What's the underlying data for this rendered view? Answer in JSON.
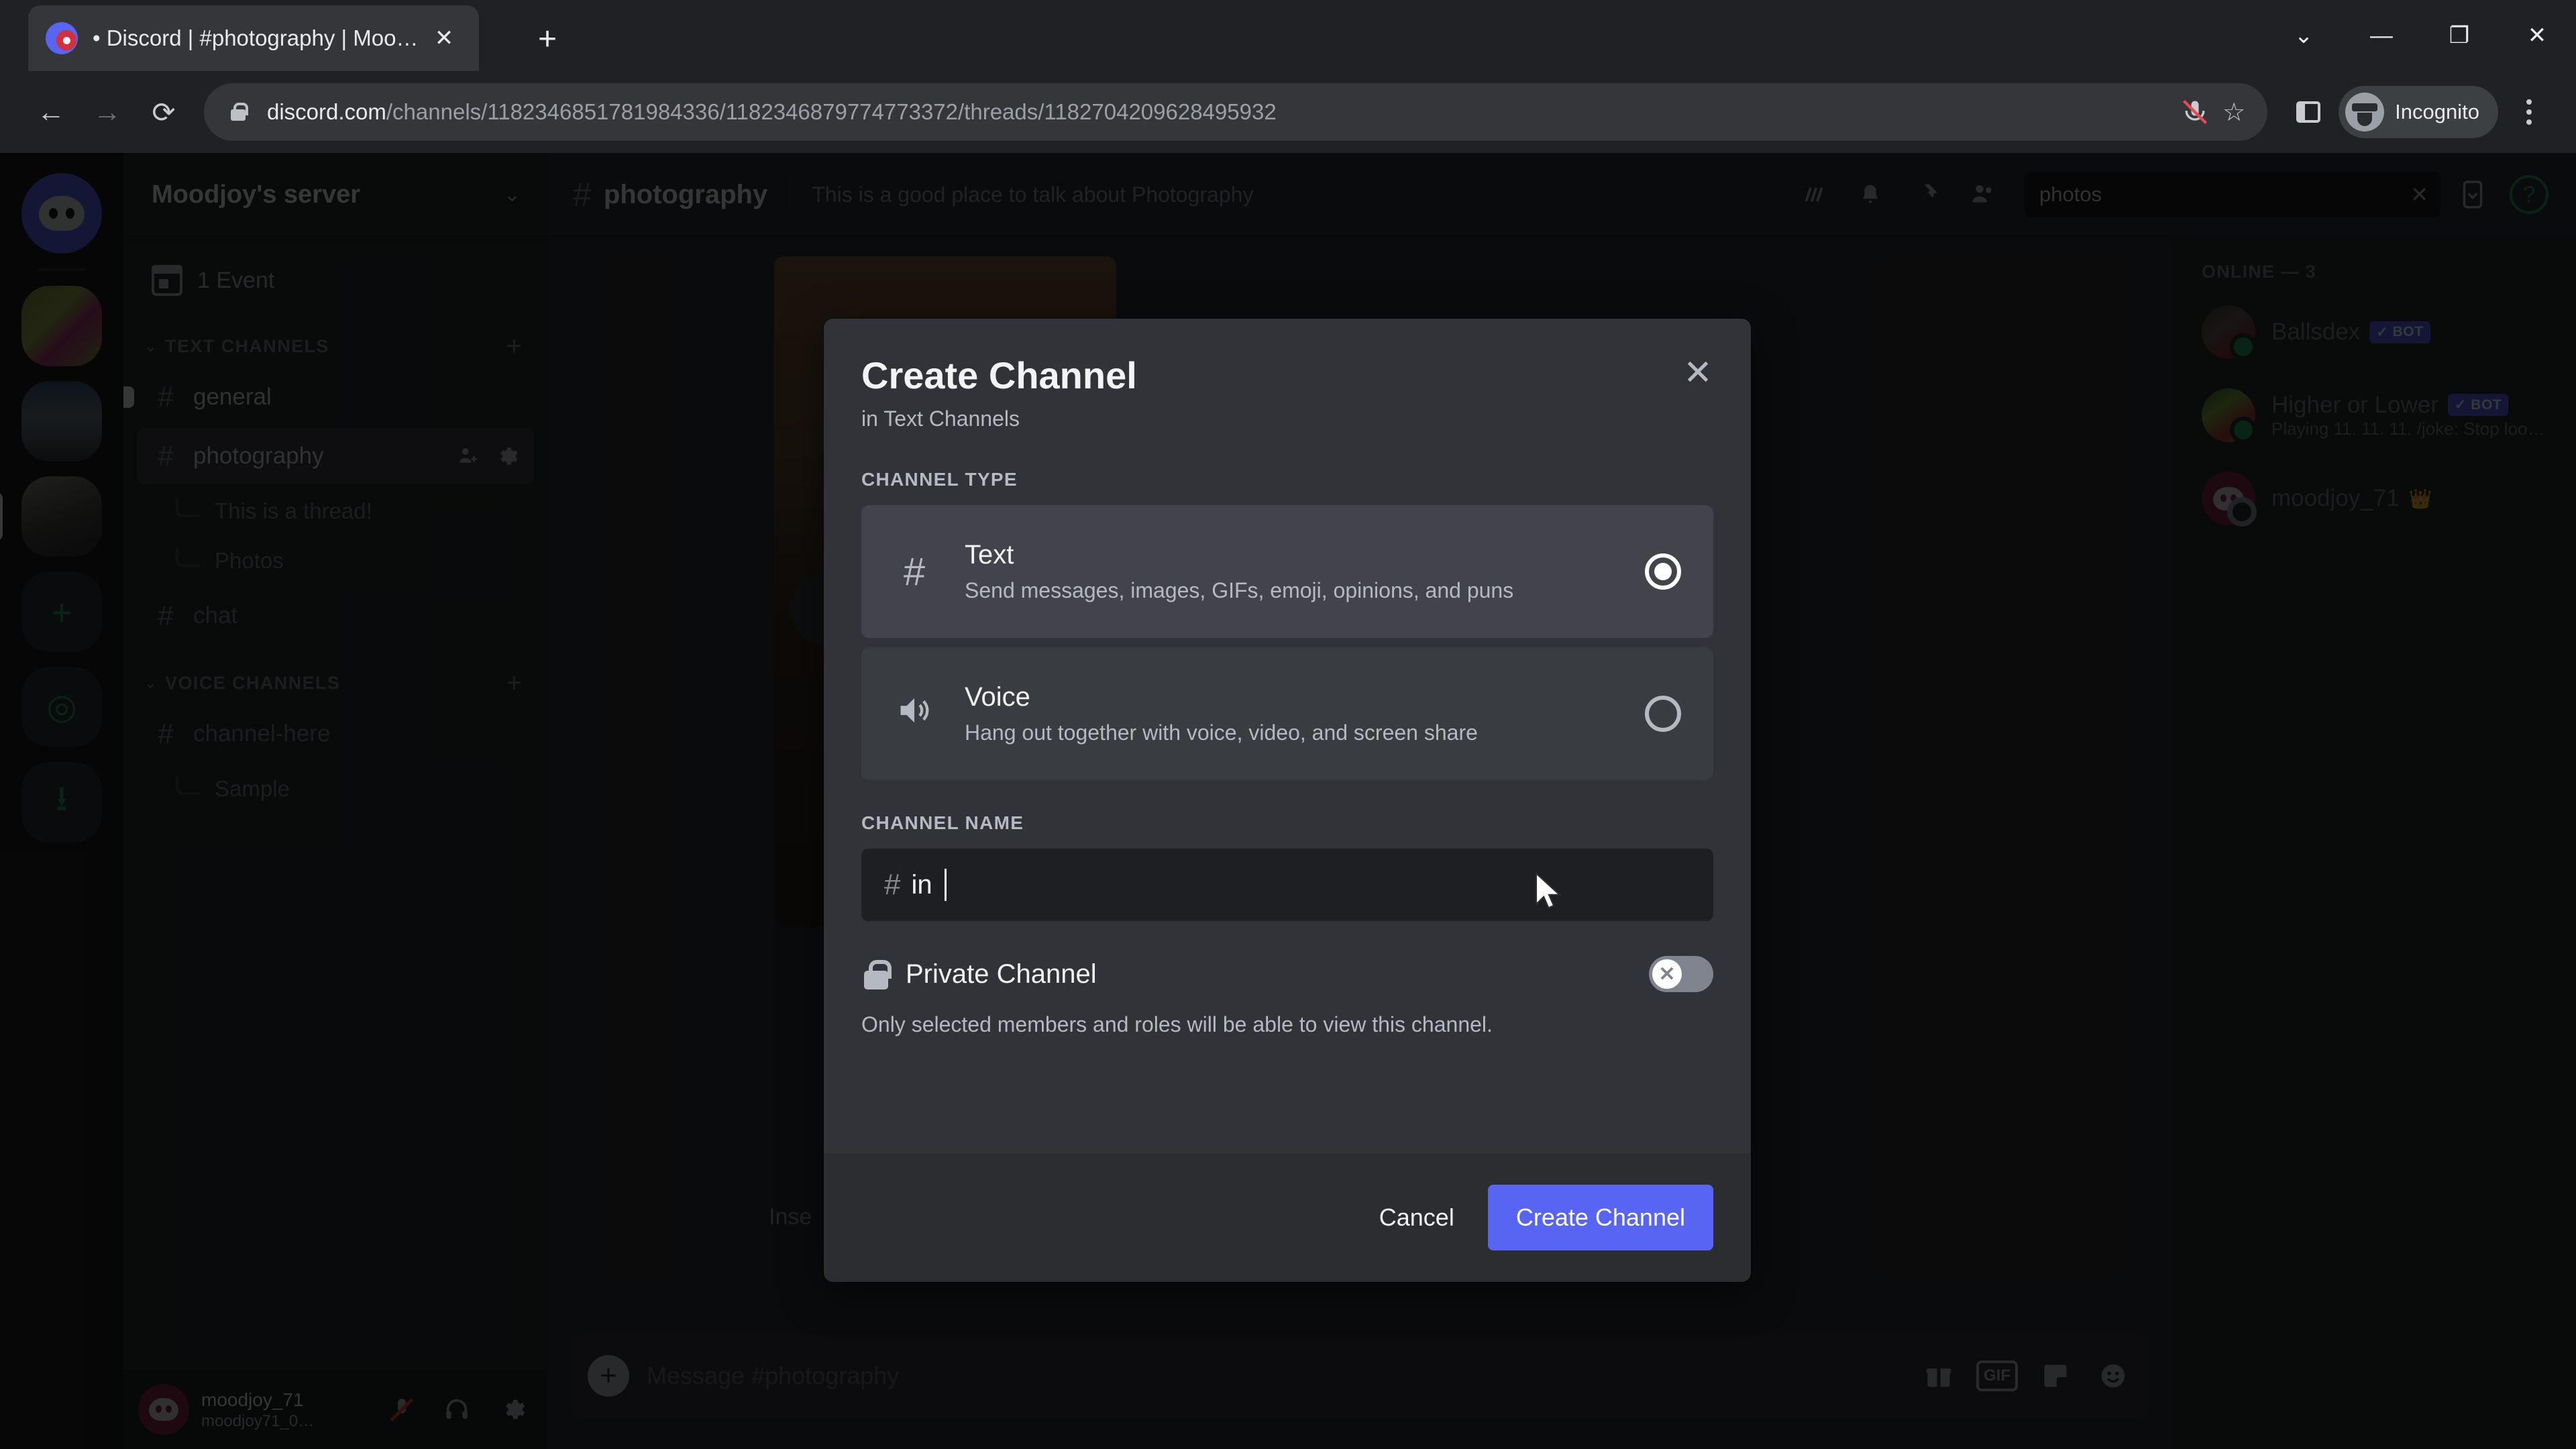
{
  "browser": {
    "tab": {
      "title": "• Discord | #photography | Moo…",
      "favicon": "discord-favicon",
      "close_label": "✕"
    },
    "newtab_label": "+",
    "window_controls": [
      {
        "name": "minimize-to-tray",
        "glyph": "⌄"
      },
      {
        "name": "minimize",
        "glyph": "—"
      },
      {
        "name": "maximize",
        "glyph": "❐"
      },
      {
        "name": "close",
        "glyph": "✕"
      }
    ],
    "nav": {
      "back": "←",
      "forward": "→",
      "reload": "⟳"
    },
    "url": {
      "domain": "discord.com",
      "path": "/channels/1182346851781984336/1182346879774773372/threads/1182704209628495932",
      "full": "discord.com/channels/1182346851781984336/1182346879774773372/threads/1182704209628495932"
    },
    "omnibox_icons": {
      "mic": "mic-muted-icon",
      "bookmark": "☆"
    },
    "profile": {
      "label": "Incognito"
    },
    "menu_label": "⋮"
  },
  "discord": {
    "guild_rail": [
      {
        "name": "home-button",
        "kind": "home"
      },
      {
        "name": "server-icon-1",
        "kind": "photo1"
      },
      {
        "name": "server-icon-2",
        "kind": "photo2"
      },
      {
        "name": "server-icon-3",
        "kind": "photo3"
      },
      {
        "name": "add-server-button",
        "kind": "action",
        "glyph": "+"
      },
      {
        "name": "explore-servers-button",
        "kind": "action",
        "glyph": "◎"
      },
      {
        "name": "download-apps-button",
        "kind": "action",
        "glyph": "⭳"
      }
    ],
    "sidebar": {
      "server_name": "Moodjoy's server",
      "server_chevron": "⌄",
      "events_label": "1 Event",
      "categories": [
        {
          "label": "TEXT CHANNELS",
          "chevron": "⌄",
          "add_label": "+",
          "channels": [
            {
              "name": "general",
              "type": "text",
              "state": "unread"
            },
            {
              "name": "photography",
              "type": "text",
              "state": "active",
              "threads": [
                "This is a thread!",
                "Photos"
              ]
            },
            {
              "name": "chat",
              "type": "text",
              "state": "normal"
            }
          ]
        },
        {
          "label": "VOICE CHANNELS",
          "chevron": "⌄",
          "add_label": "+",
          "channels": [
            {
              "name": "channel-here",
              "type": "text",
              "state": "normal",
              "threads": [
                "Sample"
              ]
            }
          ]
        }
      ]
    },
    "user_panel": {
      "display_name": "moodjoy_71",
      "username": "moodjoy71_0…",
      "buttons": [
        {
          "name": "mute-button",
          "glyph": "mic-muted-icon"
        },
        {
          "name": "deafen-button",
          "glyph": "🎧"
        },
        {
          "name": "user-settings-button",
          "glyph": "⚙"
        }
      ]
    },
    "channel_header": {
      "hash": "#",
      "title": "photography",
      "topic": "This is a good place to talk about Photography",
      "icons": [
        {
          "name": "threads-icon",
          "glyph": "≋"
        },
        {
          "name": "notifications-bell-icon",
          "glyph": "🔔"
        },
        {
          "name": "pinned-messages-icon",
          "glyph": "📌"
        },
        {
          "name": "member-list-icon",
          "glyph": "👥"
        }
      ],
      "search_value": "photos",
      "search_clear": "✕",
      "inbox_icon": "inbox-icon",
      "help_icon": "?"
    },
    "message_area": {
      "insert_text": "Inse",
      "composer_placeholder": "Message #photography",
      "composer_plus": "+",
      "composer_icons": [
        {
          "name": "gift-icon",
          "glyph": "🎁"
        },
        {
          "name": "gif-icon",
          "glyph": "GIF"
        },
        {
          "name": "sticker-icon",
          "glyph": "☺"
        },
        {
          "name": "emoji-icon",
          "glyph": "😊"
        }
      ]
    },
    "member_list": {
      "header": "ONLINE — 3",
      "members": [
        {
          "name": "Ballsdex",
          "bot": true,
          "bot_label": "BOT",
          "status": "",
          "avatar": "a1",
          "presence": "online"
        },
        {
          "name": "Higher or Lower",
          "bot": true,
          "bot_label": "BOT",
          "status": "Playing 11. 11. 11. /joke: Stop loo…",
          "avatar": "a2",
          "presence": "online"
        },
        {
          "name": "moodjoy_71",
          "bot": false,
          "bot_label": "",
          "status": "",
          "avatar": "a3",
          "presence": "idle",
          "crown": "👑"
        }
      ]
    }
  },
  "modal": {
    "title": "Create Channel",
    "subtitle": "in Text Channels",
    "close_label": "✕",
    "channel_type_label": "CHANNEL TYPE",
    "types": [
      {
        "name": "Text",
        "icon": "#",
        "description": "Send messages, images, GIFs, emoji, opinions, and puns",
        "selected": true
      },
      {
        "name": "Voice",
        "icon": "🔊",
        "description": "Hang out together with voice, video, and screen share",
        "selected": false
      }
    ],
    "channel_name_label": "CHANNEL NAME",
    "name_prefix": "#",
    "name_value": "in",
    "private": {
      "label": "Private Channel",
      "description": "Only selected members and roles will be able to view this channel.",
      "enabled": false,
      "toggle_glyph": "✕"
    },
    "cancel_label": "Cancel",
    "submit_label": "Create Channel",
    "accent_color": "#5865f2"
  }
}
